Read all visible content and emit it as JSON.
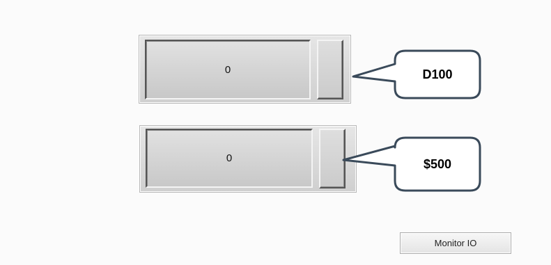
{
  "widgets": [
    {
      "value": "0",
      "callout_label": "D100"
    },
    {
      "value": "0",
      "callout_label": "$500"
    }
  ],
  "monitor_button": {
    "label": "Monitor IO"
  },
  "colors": {
    "background": "#fbfbfb",
    "callout_border": "#3a4a5a",
    "widget_face": "#d9d9d9"
  }
}
